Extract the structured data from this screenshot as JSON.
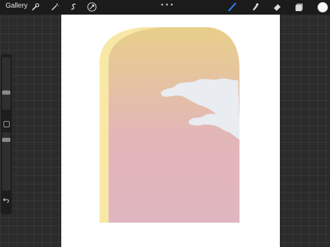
{
  "topbar": {
    "gallery_label": "Gallery",
    "more_dots": "•••",
    "left_tools": [
      {
        "name": "adjustments",
        "icon": "wrench-icon"
      },
      {
        "name": "magic-wand",
        "icon": "wand-icon"
      },
      {
        "name": "selection",
        "icon": "selection-icon"
      },
      {
        "name": "transform",
        "icon": "cursor-arrow-icon"
      }
    ],
    "right_tools": [
      {
        "name": "brush",
        "icon": "brush-icon",
        "active": true,
        "color": "#2f7cf6"
      },
      {
        "name": "smudge",
        "icon": "smudge-icon",
        "active": false
      },
      {
        "name": "eraser",
        "icon": "eraser-icon",
        "active": false
      },
      {
        "name": "layers",
        "icon": "layers-icon",
        "active": false
      }
    ],
    "current_color": "#fafafa"
  },
  "colors": {
    "accent": "#2f7cf6",
    "canvas_background": "#ffffff",
    "sky_top": "#e8cf8a",
    "sky_bottom": "#e3b5bf",
    "arch_side": "#f8e8a6",
    "clouds": "#e9ecf0"
  },
  "sidebar": {
    "brush_size_level": 0.33,
    "opacity_level": 0.62
  }
}
